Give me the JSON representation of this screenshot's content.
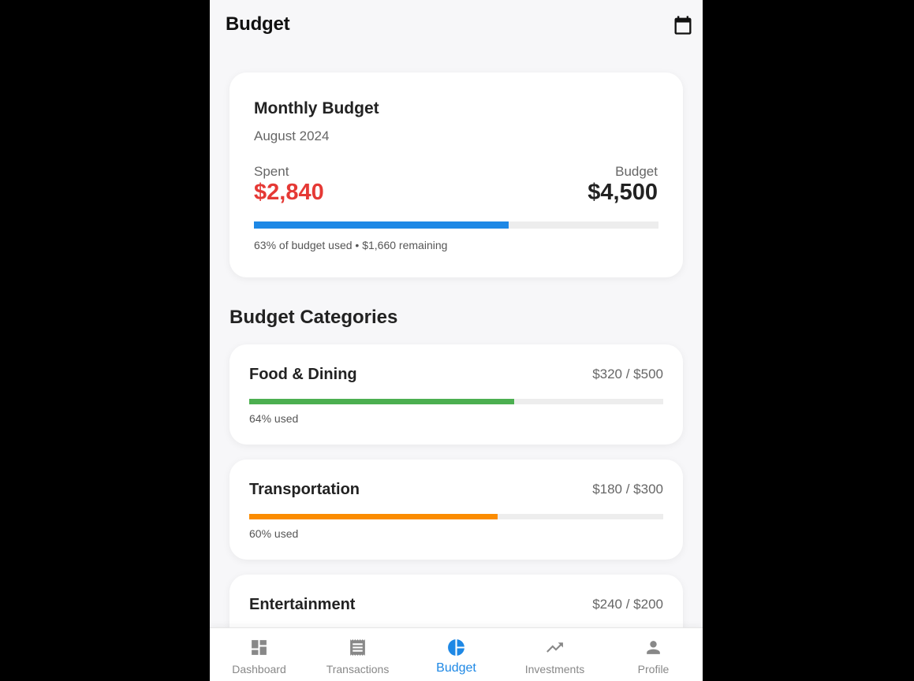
{
  "appbar": {
    "title": "Budget",
    "calendar_icon": "calendar-icon"
  },
  "summary": {
    "title": "Monthly Budget",
    "month": "August 2024",
    "spent_label": "Spent",
    "spent_value": "$2,840",
    "budget_label": "Budget",
    "budget_value": "$4,500",
    "progress": 0.63,
    "progress_color": "#1e88e5",
    "note": "63% of budget used • $1,660 remaining"
  },
  "categories_title": "Budget Categories",
  "categories": [
    {
      "name": "Food & Dining",
      "amount": "$320 / $500",
      "progress": 0.64,
      "color": "#4caf50",
      "note": "64% used"
    },
    {
      "name": "Transportation",
      "amount": "$180 / $300",
      "progress": 0.6,
      "color": "#fb8c00",
      "note": "60% used"
    },
    {
      "name": "Entertainment",
      "amount": "$240 / $200"
    }
  ],
  "nav": [
    {
      "label": "Dashboard",
      "icon": "dashboard-icon",
      "active": false
    },
    {
      "label": "Transactions",
      "icon": "receipt-icon",
      "active": false
    },
    {
      "label": "Budget",
      "icon": "pie-chart-icon",
      "active": true
    },
    {
      "label": "Investments",
      "icon": "trending-up-icon",
      "active": false
    },
    {
      "label": "Profile",
      "icon": "person-icon",
      "active": false
    }
  ],
  "colors": {
    "accent": "#1e88e5",
    "spent": "#e53935",
    "inactive": "#888888"
  }
}
